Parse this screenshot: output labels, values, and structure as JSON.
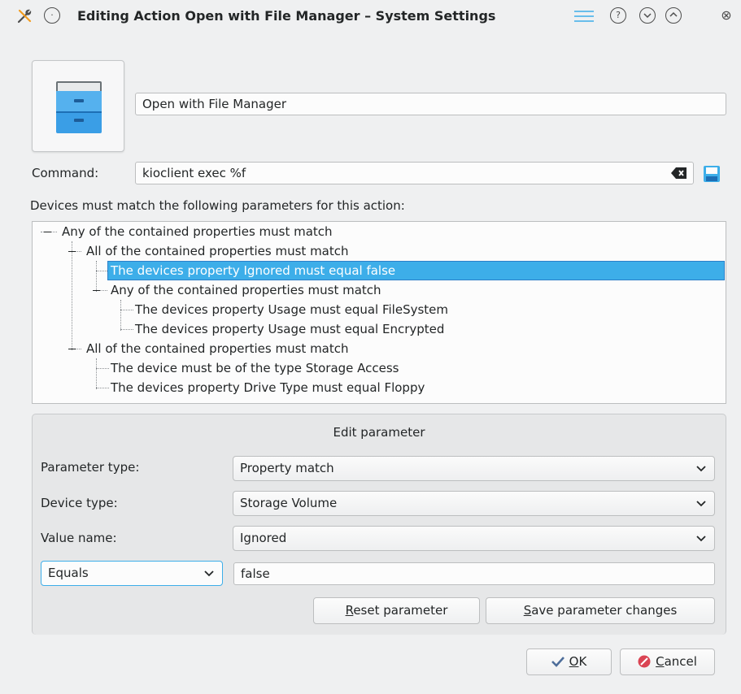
{
  "window": {
    "title": "Editing Action Open with File Manager – System Settings",
    "buttons": [
      "menu",
      "help",
      "minimize",
      "maximize",
      "close"
    ]
  },
  "action": {
    "icon": "file-manager-icon",
    "name": "Open with File Manager",
    "command_label": "Command:",
    "command_value": "kioclient exec %f"
  },
  "devices_label": "Devices must match the following parameters for this action:",
  "tree": {
    "rows": [
      "Any of the contained properties must match",
      "All of the contained properties must match",
      "The devices property Ignored must equal false",
      "Any of the contained properties must match",
      "The devices property Usage must equal FileSystem",
      "The devices property Usage must equal Encrypted",
      "All of the contained properties must match",
      "The device must be of the type Storage Access",
      "The devices property Drive Type must equal Floppy"
    ],
    "selected_index": 2
  },
  "edit": {
    "title": "Edit parameter",
    "param_type_label": "Parameter type:",
    "param_type_value": "Property match",
    "device_type_label": "Device type:",
    "device_type_value": "Storage Volume",
    "value_name_label": "Value name:",
    "value_name_value": "Ignored",
    "compare_value": "Equals",
    "match_value": "false",
    "reset_prefix": "R",
    "reset_rest": "eset parameter",
    "save_prefix": "S",
    "save_rest": "ave parameter changes"
  },
  "dialog": {
    "ok_prefix": "O",
    "ok_rest": "K",
    "cancel_prefix": "C",
    "cancel_rest": "ancel"
  },
  "colors": {
    "selection": "#3daee9",
    "window_bg": "#eff0f1"
  }
}
